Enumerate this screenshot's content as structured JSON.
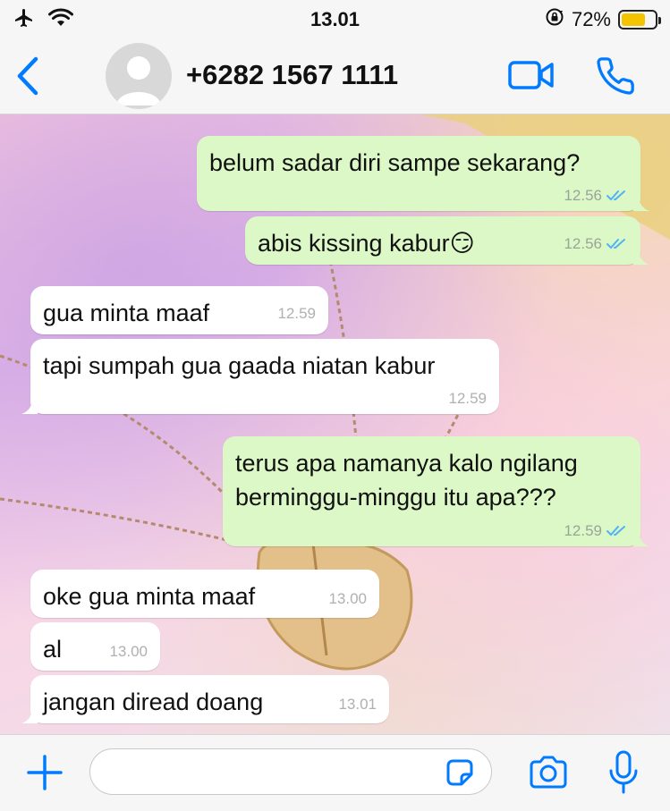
{
  "status_bar": {
    "time": "13.01",
    "battery_percent": "72%",
    "battery_level": 0.72,
    "icons": [
      "airplane-icon",
      "wifi-icon",
      "rotation-lock-icon",
      "battery-icon"
    ]
  },
  "header": {
    "contact_name": "+6282 1567 1111",
    "icons": [
      "back-chevron-icon",
      "avatar-icon",
      "video-call-icon",
      "phone-icon"
    ]
  },
  "messages": [
    {
      "direction": "out",
      "text": "belum sadar diri sampe sekarang?",
      "time": "12.56",
      "read": true
    },
    {
      "direction": "out",
      "text": "abis kissing kabur😏",
      "time": "12.56",
      "read": true
    },
    {
      "direction": "in",
      "text": "gua minta maaf",
      "time": "12.59"
    },
    {
      "direction": "in",
      "text": "tapi sumpah gua gaada niatan kabur",
      "time": "12.59"
    },
    {
      "direction": "out",
      "text": "terus apa namanya kalo ngilang berminggu-minggu itu apa???",
      "time": "12.59",
      "read": true
    },
    {
      "direction": "in",
      "text": "oke gua minta maaf",
      "time": "13.00"
    },
    {
      "direction": "in",
      "text": "al",
      "time": "13.00"
    },
    {
      "direction": "in",
      "text": "jangan diread doang",
      "time": "13.01"
    }
  ],
  "input_bar": {
    "placeholder": "",
    "value": "",
    "icons": [
      "plus-icon",
      "sticker-icon",
      "camera-icon",
      "microphone-icon"
    ]
  },
  "colors": {
    "accent": "#007aff",
    "outgoing_bubble": "#dcf8c6",
    "incoming_bubble": "#ffffff",
    "read_ticks": "#4fb3f6",
    "battery": "#f5c400"
  }
}
